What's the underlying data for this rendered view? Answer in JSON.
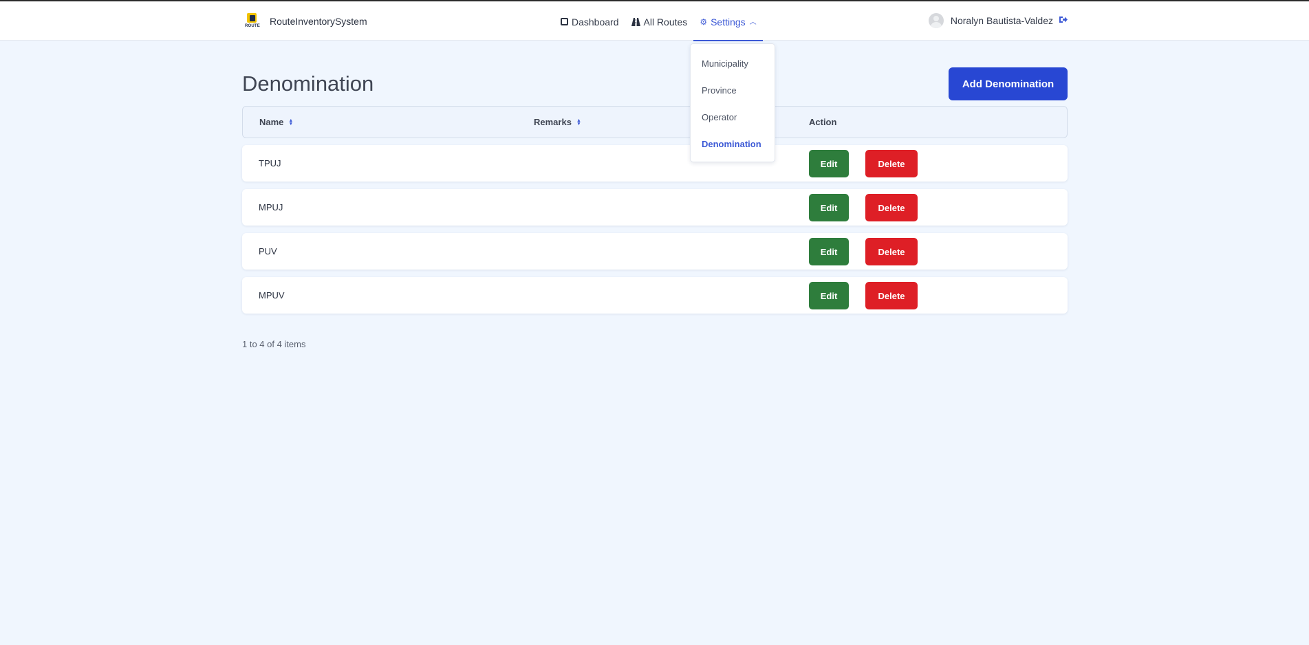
{
  "header": {
    "brand": {
      "name": "RouteInventorySystem",
      "logo_text": "ROUTE",
      "logo_icon": "route-logo"
    },
    "nav": [
      {
        "label": "Dashboard",
        "icon": "dashboard-icon"
      },
      {
        "label": "All Routes",
        "icon": "road-icon"
      },
      {
        "label": "Settings",
        "icon": "gear-icon",
        "active": true,
        "expanded": true
      }
    ],
    "user": {
      "name": "Noralyn Bautista-Valdez",
      "icon": "logout-icon"
    }
  },
  "settings_menu": {
    "items": [
      {
        "label": "Municipality"
      },
      {
        "label": "Province"
      },
      {
        "label": "Operator"
      },
      {
        "label": "Denomination",
        "selected": true
      }
    ]
  },
  "page": {
    "title": "Denomination",
    "add_button": "Add Denomination"
  },
  "table": {
    "columns": [
      {
        "label": "Name",
        "sortable": true
      },
      {
        "label": "Remarks",
        "sortable": true
      },
      {
        "label": "Action",
        "sortable": false
      }
    ],
    "rows": [
      {
        "name": "TPUJ",
        "remarks": ""
      },
      {
        "name": "MPUJ",
        "remarks": ""
      },
      {
        "name": "PUV",
        "remarks": ""
      },
      {
        "name": "MPUV",
        "remarks": ""
      }
    ],
    "edit_label": "Edit",
    "delete_label": "Delete",
    "pagination": "1 to 4 of 4 items"
  },
  "colors": {
    "primary": "#2847d3",
    "accent": "#3d5ad6",
    "edit": "#2e7d3c",
    "delete": "#de1f26",
    "background": "#f0f6fe"
  }
}
